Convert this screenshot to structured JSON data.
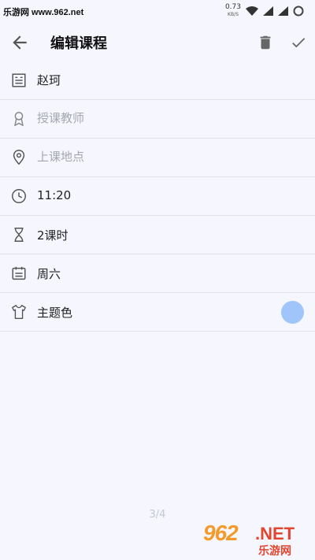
{
  "status_bar": {
    "watermark_text": "乐游网 www.962.net",
    "speed_value": "0.73",
    "speed_unit": "KB/S",
    "icons": [
      "wifi-icon",
      "signal-icon",
      "signal-icon",
      "battery-icon"
    ]
  },
  "app_bar": {
    "title": "编辑课程",
    "back_icon": "arrow-back-icon",
    "delete_icon": "trash-icon",
    "confirm_icon": "check-icon"
  },
  "form": {
    "course_name": {
      "value": "赵珂",
      "icon": "notebook-icon"
    },
    "teacher": {
      "value": "",
      "placeholder": "授课教师",
      "icon": "award-icon"
    },
    "location": {
      "value": "",
      "placeholder": "上课地点",
      "icon": "location-pin-icon"
    },
    "time": {
      "value": "11:20",
      "icon": "clock-icon"
    },
    "duration": {
      "value": "2课时",
      "icon": "hourglass-icon"
    },
    "weekday": {
      "value": "周六",
      "icon": "calendar-icon"
    },
    "theme_color": {
      "label": "主题色",
      "icon": "shirt-icon",
      "color": "#9fc5fb"
    }
  },
  "pager": {
    "text": "3/4"
  },
  "watermark": {
    "number": "962",
    "suffix": ".NET",
    "cn_text": "乐游网"
  }
}
